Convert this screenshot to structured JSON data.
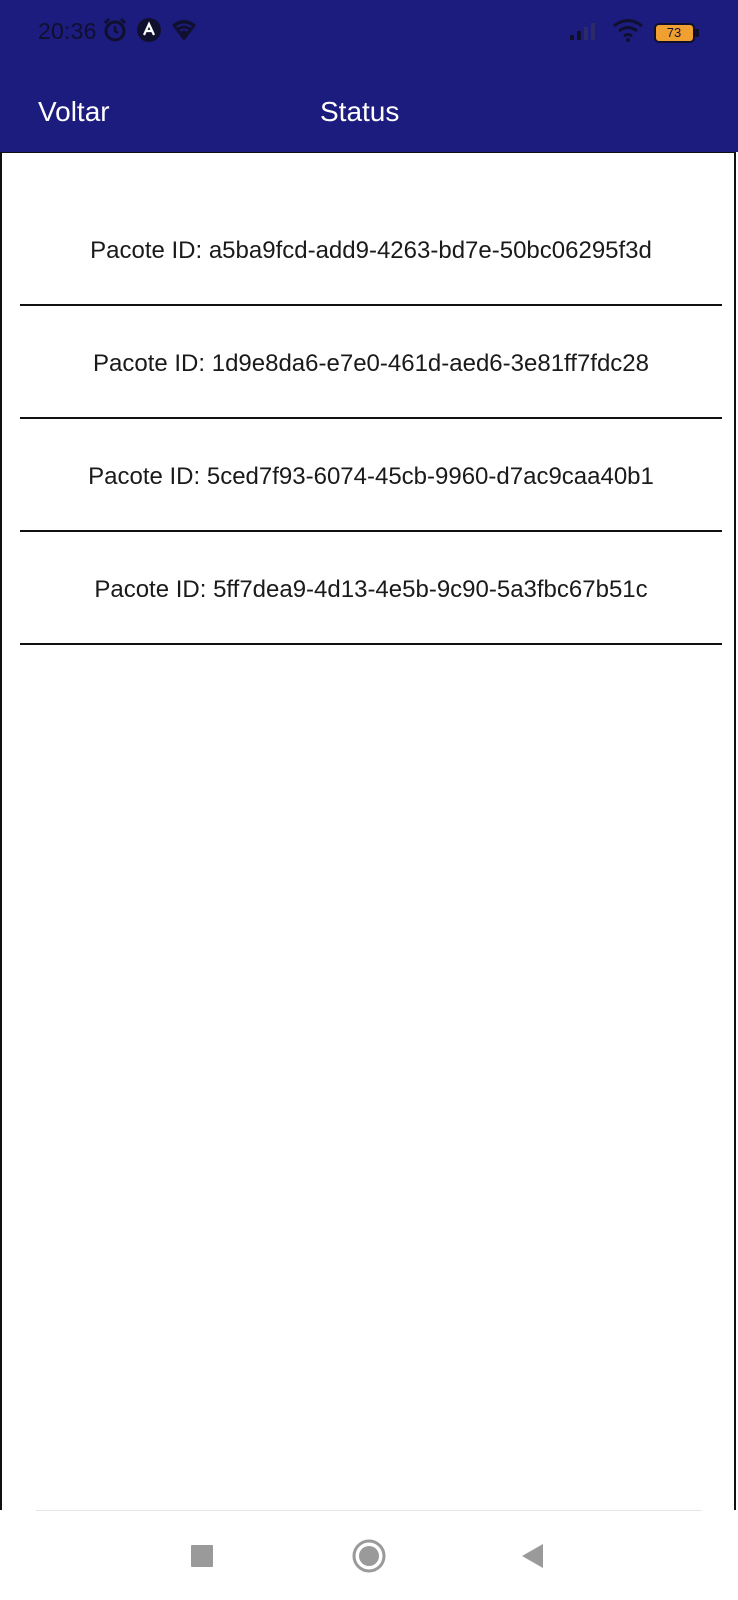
{
  "status_bar": {
    "time": "20:36",
    "battery_level": "73",
    "left_icons": [
      "alarm-icon",
      "app-notification-icon",
      "vpn-wifi-icon"
    ],
    "right_icons": [
      "signal-icon",
      "wifi-icon",
      "battery-icon"
    ]
  },
  "app_bar": {
    "back_label": "Voltar",
    "title": "Status"
  },
  "packages": [
    {
      "label": "Pacote ID: a5ba9fcd-add9-4263-bd7e-50bc06295f3d"
    },
    {
      "label": "Pacote ID: 1d9e8da6-e7e0-461d-aed6-3e81ff7fdc28"
    },
    {
      "label": "Pacote ID: 5ced7f93-6074-45cb-9960-d7ac9caa40b1"
    },
    {
      "label": "Pacote ID: 5ff7dea9-4d13-4e5b-9c90-5a3fbc67b51c"
    }
  ],
  "nav_bar": {
    "buttons": [
      "recents-square-icon",
      "home-circle-icon",
      "back-triangle-icon"
    ]
  },
  "colors": {
    "header_bg": "#1c1b7e",
    "header_text": "#ffffff",
    "battery_fill": "#f0a030"
  }
}
